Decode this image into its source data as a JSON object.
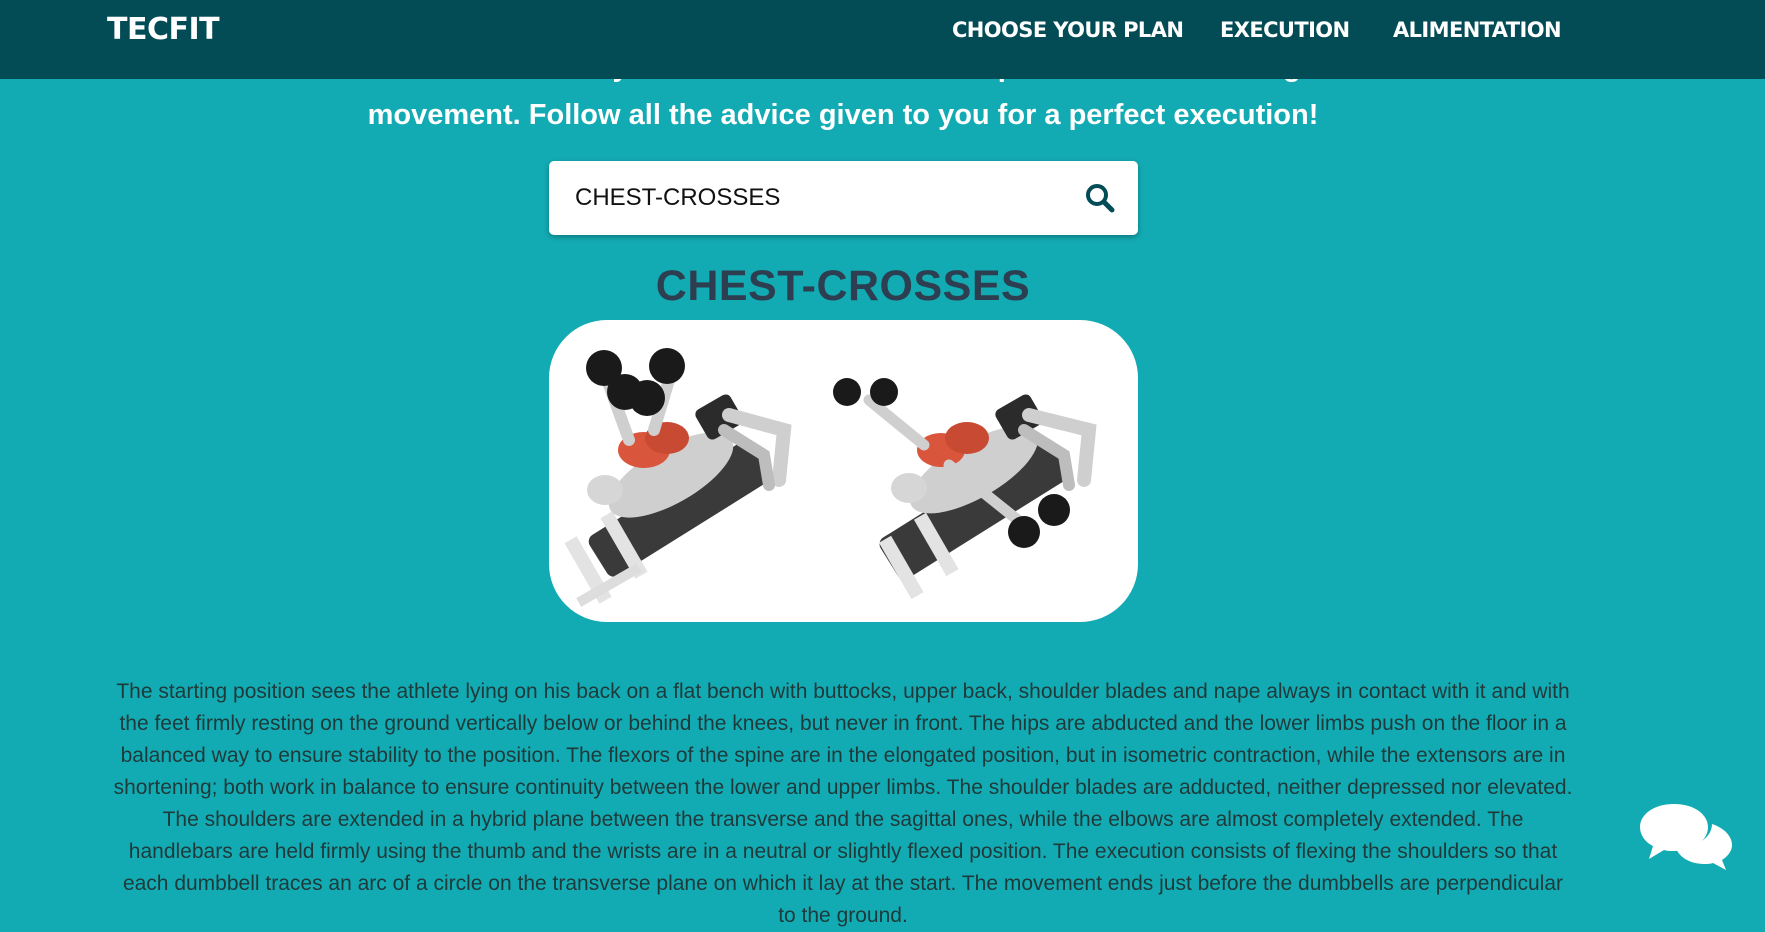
{
  "navbar": {
    "brand": "TECFIT",
    "links": [
      "CHOOSE YOUR PLAN",
      "EXECUTION",
      "ALIMENTATION"
    ]
  },
  "intro": {
    "line1": "Enter the name of your exercise and see its explanation and the target",
    "line2": "movement. Follow all the advice given to you for a perfect execution!"
  },
  "search": {
    "value": "CHEST-CROSSES",
    "icon": "search-icon"
  },
  "exercise": {
    "title": "CHEST-CROSSES",
    "image": "chest-crosses-illustration",
    "description": "The starting position sees the athlete lying on his back on a flat bench with buttocks, upper back, shoulder blades and nape always in contact with it and with the feet firmly resting on the ground vertically below or behind the knees, but never in front. The hips are abducted and the lower limbs push on the floor in a balanced way to ensure stability to the position. The flexors of the spine are in the elongated position, but in isometric contraction, while the extensors are in shortening; both work in balance to ensure continuity between the lower and upper limbs. The shoulder blades are adducted, neither depressed nor elevated. The shoulders are extended in a hybrid plane between the transverse and the sagittal ones, while the elbows are almost completely extended. The handlebars are held firmly using the thumb and the wrists are in a neutral or slightly flexed position. The execution consists of flexing the shoulders so that each dumbbell traces an arc of a circle on the transverse plane on which it lay at the start. The movement ends just before the dumbbells are perpendicular to the ground."
  },
  "chat": {
    "icon": "chat-bubbles-icon"
  },
  "colors": {
    "navbar": "#034c56",
    "background": "#13abb3",
    "title": "#2c3e50",
    "muscle": "#d9553b"
  }
}
